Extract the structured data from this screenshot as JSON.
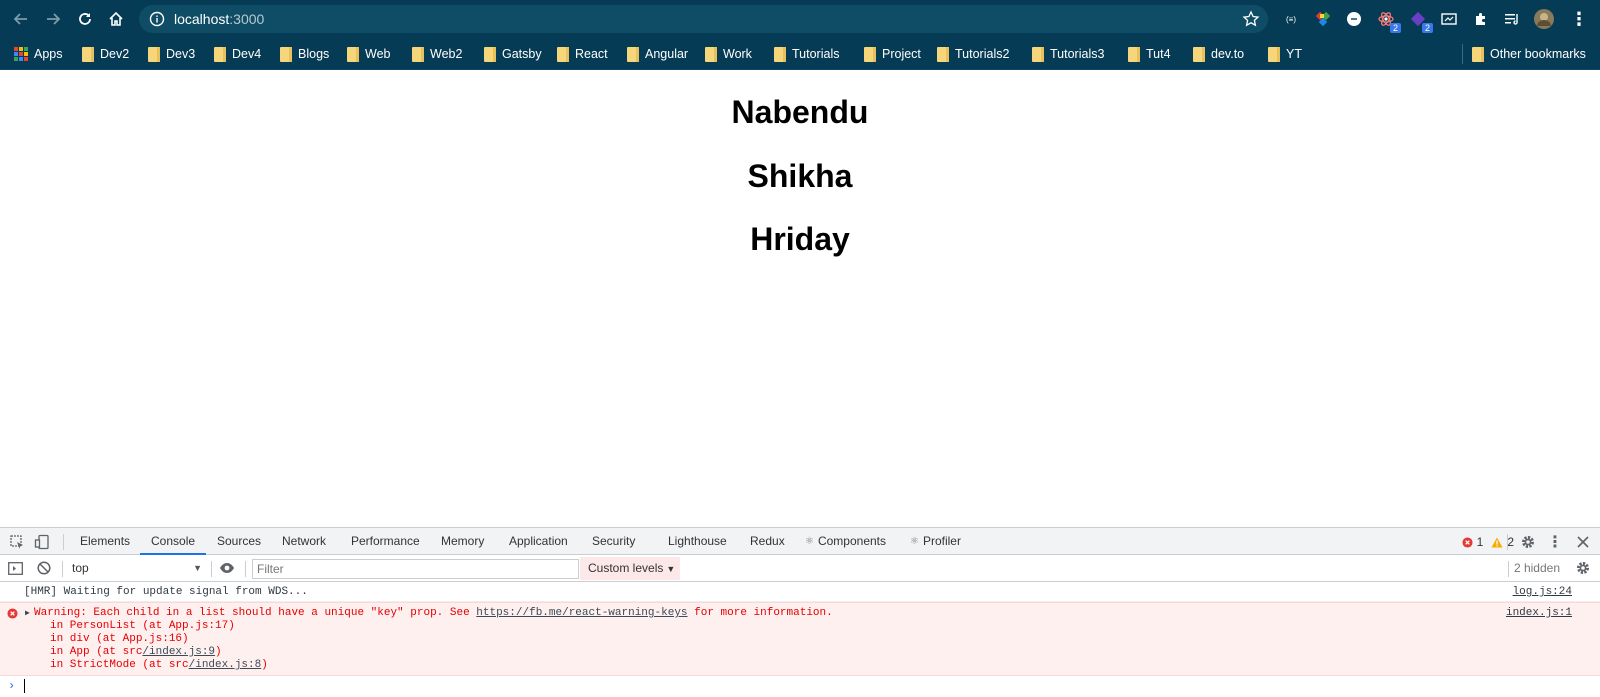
{
  "browser": {
    "url_host": "localhost",
    "url_port": ":3000",
    "extensions": [
      {
        "name": "extension-cheerio",
        "glyph": "(≡)"
      },
      {
        "name": "extension-colorzilla",
        "glyph": ""
      },
      {
        "name": "extension-circle",
        "glyph": "(-)"
      },
      {
        "name": "extension-react-devtools",
        "badge": "2"
      },
      {
        "name": "extension-redux-devtools",
        "badge": "2"
      },
      {
        "name": "extension-screen",
        "glyph": ""
      },
      {
        "name": "extensions-puzzle",
        "glyph": ""
      },
      {
        "name": "reading-list",
        "glyph": ""
      },
      {
        "name": "profile-avatar",
        "glyph": ""
      },
      {
        "name": "chrome-menu",
        "glyph": "⋮"
      }
    ]
  },
  "bookmarks": {
    "apps": "Apps",
    "items": [
      "Dev2",
      "Dev3",
      "Dev4",
      "Blogs",
      "Web",
      "Web2",
      "Gatsby",
      "React",
      "Angular",
      "Work",
      "Tutorials",
      "Project",
      "Tutorials2",
      "Tutorials3",
      "Tut4",
      "dev.to",
      "YT"
    ],
    "other": "Other bookmarks"
  },
  "page": {
    "persons": [
      "Nabendu",
      "Shikha",
      "Hriday"
    ]
  },
  "devtools": {
    "tabs": [
      "Elements",
      "Console",
      "Sources",
      "Network",
      "Performance",
      "Memory",
      "Application",
      "Security",
      "Lighthouse",
      "Redux",
      "Components",
      "Profiler"
    ],
    "active_tab": "Console",
    "error_count": "1",
    "warning_count": "2",
    "context": "top",
    "filter_placeholder": "Filter",
    "levels": "Custom levels",
    "hidden": "2 hidden",
    "log": {
      "message": "[HMR] Waiting for update signal from WDS...",
      "source": "log.js:24"
    },
    "error": {
      "prefix": "Warning: Each child in a list should have a unique \"key\" prop. See ",
      "link": "https://fb.me/react-warning-keys",
      "suffix": " for more information.",
      "source": "index.js:1",
      "stack": [
        {
          "pre": "in PersonList (at App.js:17)",
          "link": "",
          "post": ""
        },
        {
          "pre": "in div (at App.js:16)",
          "link": "",
          "post": ""
        },
        {
          "pre": "in App (at src",
          "link": "/index.js:9",
          "post": ")"
        },
        {
          "pre": "in StrictMode (at src",
          "link": "/index.js:8",
          "post": ")"
        }
      ]
    }
  },
  "colors": {
    "chrome_bg": "#063b55",
    "omnibox_bg": "#0f4d66",
    "active_tab_underline": "#1a73e8",
    "error_text": "#e50000",
    "error_bg": "#fff0f0"
  }
}
